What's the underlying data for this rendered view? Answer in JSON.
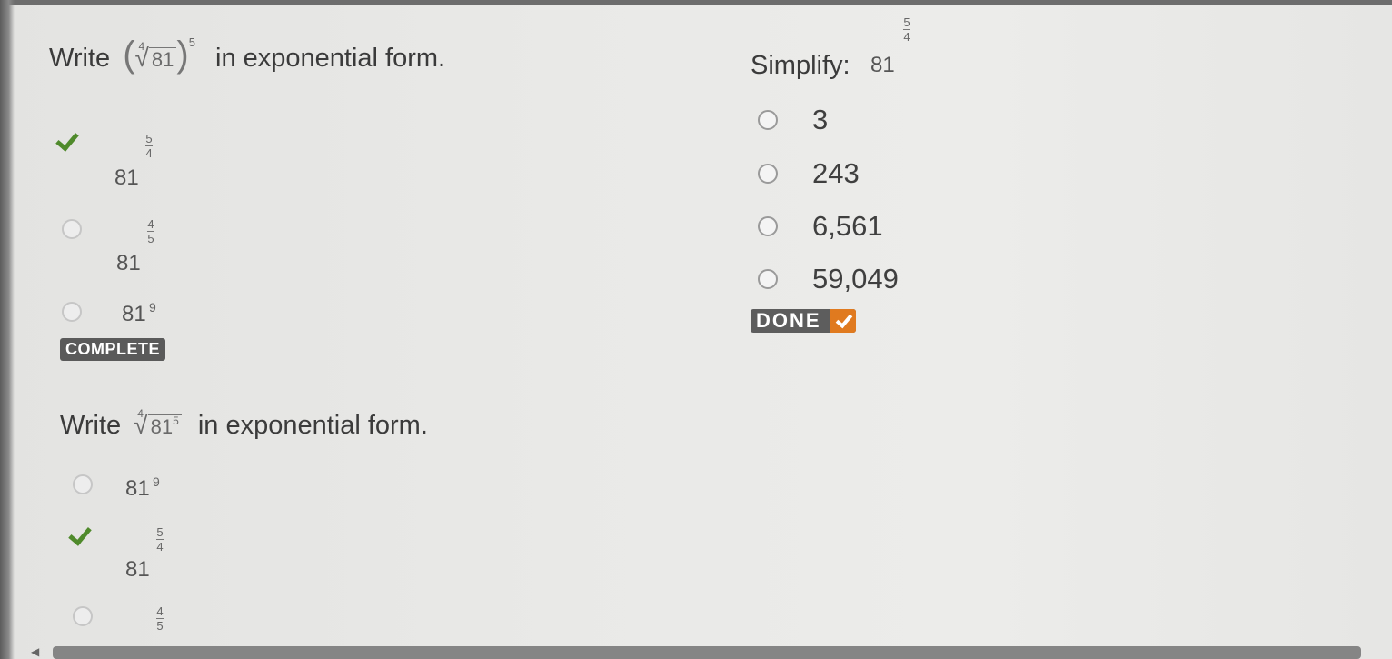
{
  "q1": {
    "write_label": "Write",
    "index": "4",
    "radicand": "81",
    "outer_exp": "5",
    "suffix": "in exponential form.",
    "options": [
      {
        "base": "81",
        "num": "5",
        "den": "4",
        "state": "checked"
      },
      {
        "base": "81",
        "num": "4",
        "den": "5",
        "state": "empty"
      },
      {
        "base": "81",
        "exp": "9",
        "state": "empty"
      }
    ],
    "status_badge": "COMPLETE"
  },
  "q2": {
    "simplify_label": "Simplify:",
    "base": "81",
    "num": "5",
    "den": "4",
    "options": [
      "3",
      "243",
      "6,561",
      "59,049"
    ],
    "done_label": "DONE",
    "accent_color": "#e07a1f"
  },
  "q3": {
    "write_label": "Write",
    "index": "4",
    "radicand": "81",
    "inner_exp": "5",
    "suffix": "in exponential form.",
    "options": [
      {
        "base": "81",
        "exp": "9",
        "state": "empty"
      },
      {
        "base": "81",
        "num": "5",
        "den": "4",
        "state": "checked"
      },
      {
        "num": "4",
        "den": "5",
        "state": "empty"
      }
    ]
  },
  "colors": {
    "check_green": "#4f8a2b",
    "badge_gray": "#5a5a5a"
  },
  "icons": {
    "check": "check-icon",
    "radio": "radio-icon",
    "done_check": "checkmark-box-icon"
  }
}
